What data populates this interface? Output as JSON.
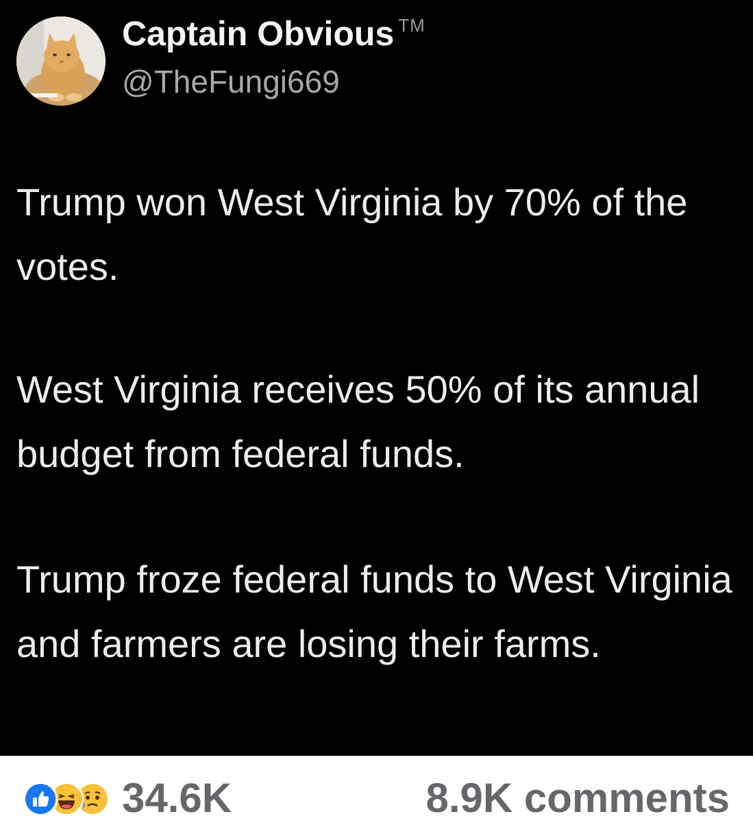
{
  "author": {
    "name": "Captain Obvious",
    "trademark": "TM",
    "handle": "@TheFungi669",
    "avatar_icon": "cat-avatar"
  },
  "post": {
    "paragraphs": [
      "Trump won West Virginia by 70% of the votes.",
      "West Virginia receives 50% of its annual budget from federal funds.",
      "Trump froze federal funds to West Virginia and farmers are losing their farms."
    ]
  },
  "engagement": {
    "reaction_icons": [
      "like-icon",
      "haha-icon",
      "sad-icon"
    ],
    "reaction_count": "34.6K",
    "comments_label": "8.9K comments"
  },
  "colors": {
    "background": "#000000",
    "text": "#ededed",
    "handle": "#a8a8a8",
    "footer_text": "#65676b",
    "like_blue": "#1877f2",
    "emoji_yellow": "#f7c13a"
  }
}
